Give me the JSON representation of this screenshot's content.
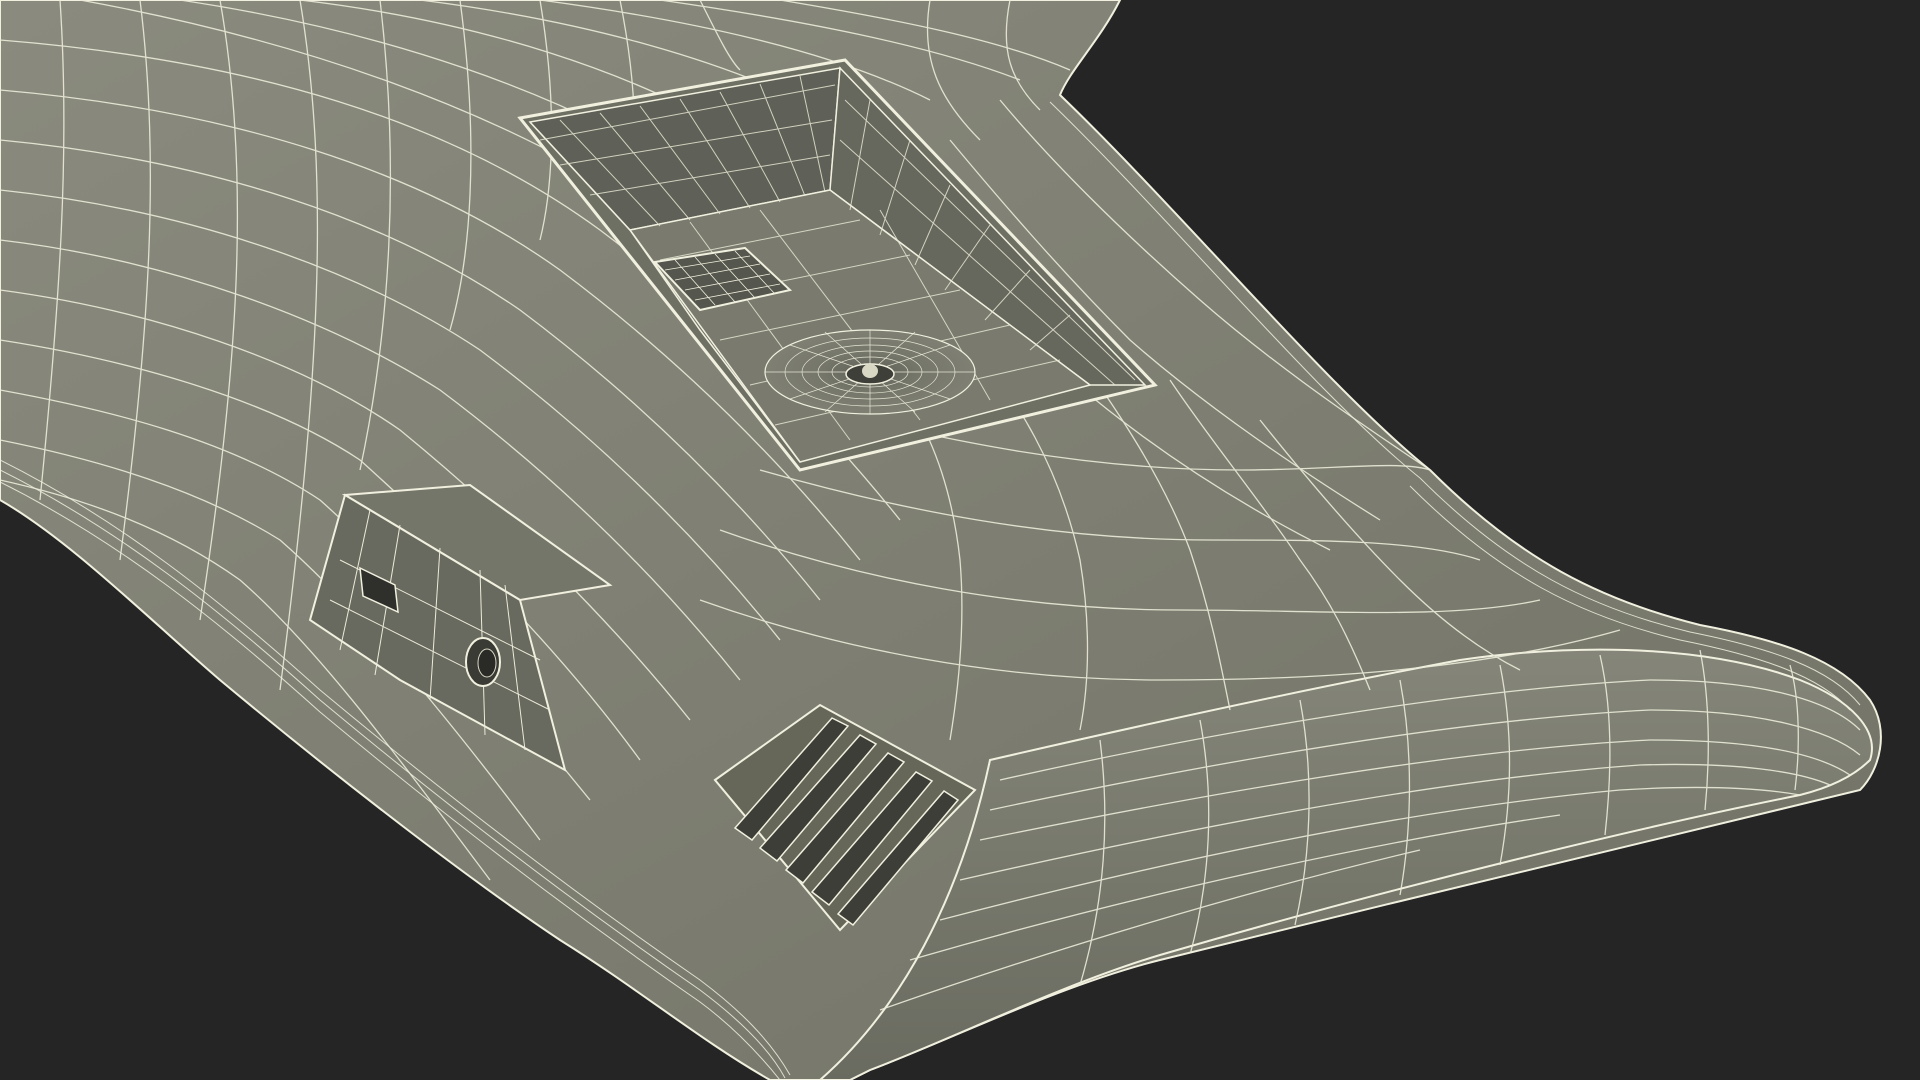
{
  "scene": {
    "subject": "wireframe-render",
    "render_mode": "shaded-wireframe",
    "colors": {
      "background": "#252525",
      "surface": "#7b7c6f",
      "surface_light": "#8a8b7e",
      "surface_dark": "#65665b",
      "cavity": "#585950",
      "wire": "#f1f0df",
      "wire_dim": "#d9d8c6"
    }
  }
}
